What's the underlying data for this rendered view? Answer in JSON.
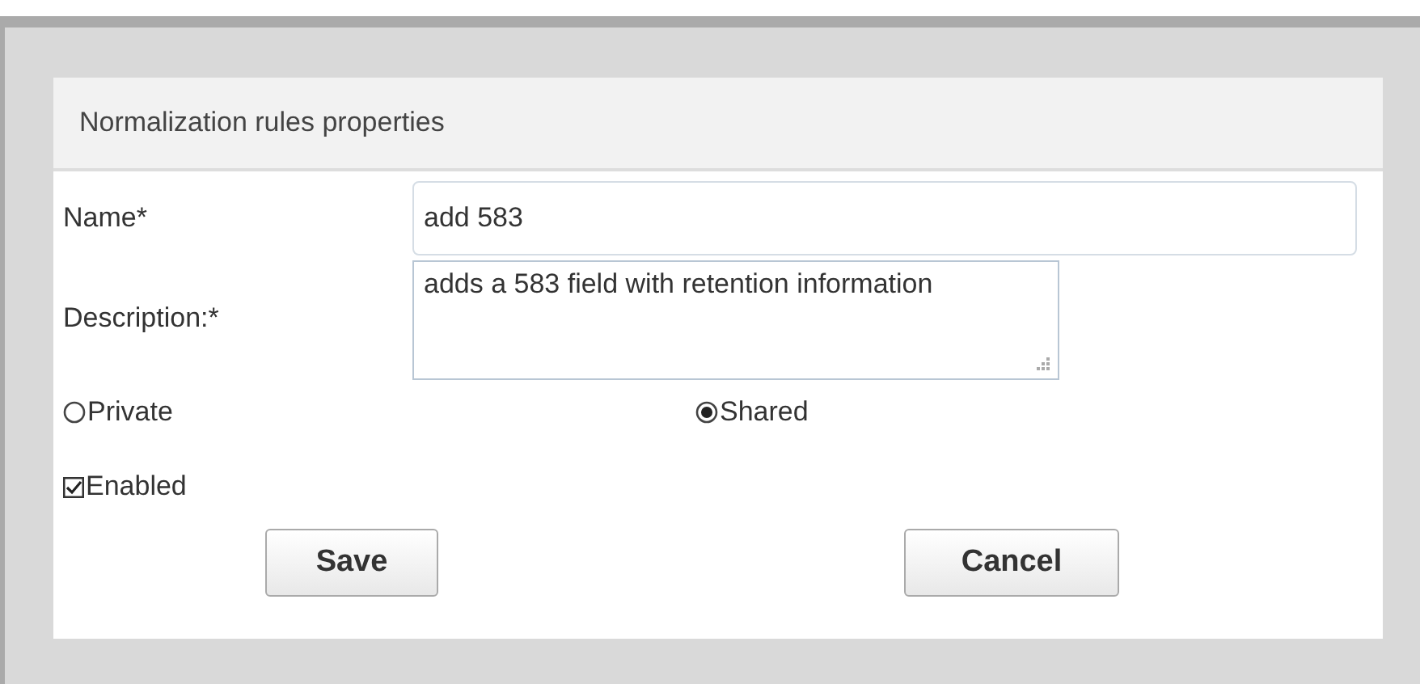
{
  "panel": {
    "title": "Normalization rules properties"
  },
  "fields": [
    {
      "label": "Name*",
      "value": "add 583",
      "kind": "input"
    },
    {
      "label": "Description:*",
      "value": "adds a 583 field with retention information",
      "kind": "textarea"
    }
  ],
  "visibility": [
    {
      "label": "Private",
      "selected": false
    },
    {
      "label": "Shared",
      "selected": true
    }
  ],
  "enabled": {
    "label": "Enabled",
    "checked": true
  },
  "buttons": [
    "Save",
    "Cancel"
  ]
}
